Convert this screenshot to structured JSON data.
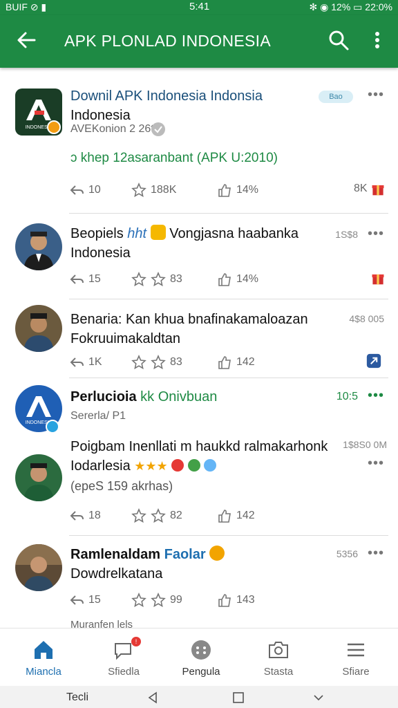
{
  "status": {
    "left": "BUIF ⊘ ▮",
    "time": "5:41",
    "right": "✻ ◉ 12% ▭ 22:0%"
  },
  "appbar": {
    "title": "APK PLONLAD INDONESIA"
  },
  "posts": [
    {
      "title_line1": "Downil APK  Indonesia Indonsia",
      "title_line2": "Indonesia",
      "subtitle": "AVEKonion 2 26th",
      "tag": "Bao",
      "body": "ↄ khep 12asaranbant (APK U:2010)",
      "actions": {
        "reply": "10",
        "star": "188K",
        "like": "14%",
        "extra": "8K"
      }
    },
    {
      "title_line1": "Beopiels",
      "title_accent": "hht",
      "title_rest": "Vongjasna haabanka",
      "title_line2": "Indonesia",
      "meta": "1S$8",
      "actions": {
        "reply": "15",
        "star": "83",
        "like": "14%"
      }
    },
    {
      "title_line1": "Benaria: Kan khua bnafinakamaloazan",
      "title_line2": "Fokruuimakaldtan",
      "meta": "4$8 005",
      "actions": {
        "reply": "1K",
        "star": "83",
        "like": "142"
      }
    },
    {
      "title_line1": "Perlucioia",
      "title_accent": "kk Onivbuan",
      "subtitle": "Sererla/ P1",
      "meta": "10:5"
    },
    {
      "title_line1": "Poigbam Inenllati m haukkd ralmakarhonk",
      "title_line2": "Iodarlesia",
      "subtitle": "(epeS 159 akrhas)",
      "meta": "1$8S0 0M",
      "actions": {
        "reply": "18",
        "star": "82",
        "like": "142"
      }
    },
    {
      "title_line1": "Ramlenaldam",
      "title_accent": "Faolar",
      "title_line2": "Dowdrelkatana",
      "meta": "5356",
      "actions": {
        "reply": "15",
        "star": "99",
        "like": "143"
      },
      "cutoff": "Muranfen lels"
    }
  ],
  "bottomnav": [
    {
      "label": "Miancla",
      "active": true
    },
    {
      "label": "Sfiedla",
      "badge": "!"
    },
    {
      "label": "Pengula"
    },
    {
      "label": "Stasta"
    },
    {
      "label": "Sfiare"
    }
  ],
  "sysnav": {
    "label": "Tecli"
  },
  "colors": {
    "brand_green": "#1e8a44",
    "active_blue": "#1e6fb0"
  }
}
